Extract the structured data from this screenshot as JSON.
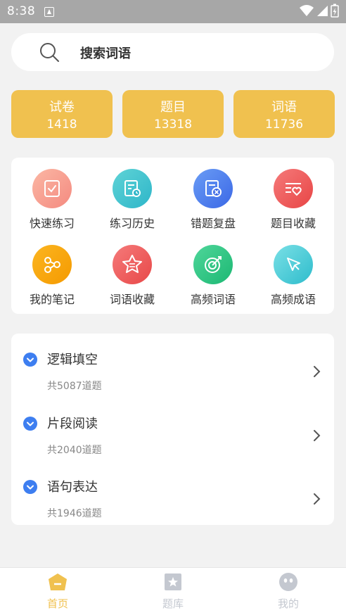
{
  "status_bar": {
    "time": "8:38"
  },
  "search": {
    "placeholder": "搜索词语"
  },
  "stats": [
    {
      "label": "试卷",
      "value": "1418"
    },
    {
      "label": "题目",
      "value": "13318"
    },
    {
      "label": "词语",
      "value": "11736"
    }
  ],
  "menu": [
    {
      "label": "快速练习",
      "icon": "quick-practice-icon"
    },
    {
      "label": "练习历史",
      "icon": "practice-history-icon"
    },
    {
      "label": "错题复盘",
      "icon": "wrong-review-icon"
    },
    {
      "label": "题目收藏",
      "icon": "question-favorite-icon"
    },
    {
      "label": "我的笔记",
      "icon": "notes-icon"
    },
    {
      "label": "词语收藏",
      "icon": "word-favorite-icon"
    },
    {
      "label": "高频词语",
      "icon": "high-freq-word-icon"
    },
    {
      "label": "高频成语",
      "icon": "high-freq-idiom-icon"
    }
  ],
  "categories": [
    {
      "title": "逻辑填空",
      "count": "共5087道题"
    },
    {
      "title": "片段阅读",
      "count": "共2040道题"
    },
    {
      "title": "语句表达",
      "count": "共1946道题"
    }
  ],
  "nav": [
    {
      "label": "首页",
      "active": true
    },
    {
      "label": "题库",
      "active": false
    },
    {
      "label": "我的",
      "active": false
    }
  ],
  "colors": {
    "accent": "#f0c14f",
    "check_blue": "#3d7ef0",
    "nav_inactive": "#c4c8d0"
  }
}
